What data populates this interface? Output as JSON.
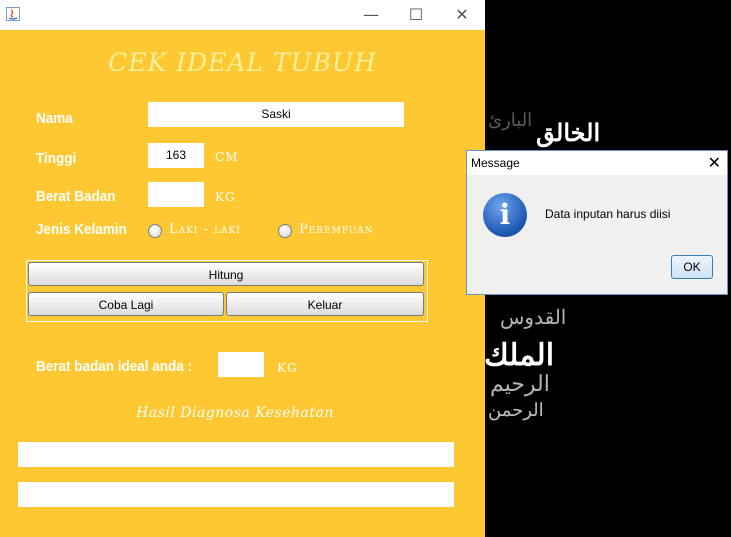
{
  "window": {
    "minimize_glyph": "—",
    "maximize_glyph": "☐",
    "close_glyph": "✕"
  },
  "form": {
    "title": "CEK IDEAL TUBUH",
    "nama_label": "Nama",
    "nama_value": "Saski",
    "tinggi_label": "Tinggi",
    "tinggi_value": "163",
    "tinggi_unit": "CM",
    "berat_label": "Berat Badan",
    "berat_value": "",
    "berat_unit": "KG",
    "gender_label": "Jenis Kelamin",
    "gender_options": [
      "Laki - laki",
      "Perempuan"
    ],
    "hitung_button": "Hitung",
    "coba_lagi_button": "Coba Lagi",
    "keluar_button": "Keluar",
    "ideal_label": "Berat badan ideal anda :",
    "ideal_value": "",
    "ideal_unit": "KG",
    "diagnosa_heading": "Hasil Diagnosa Kesehatan",
    "diagnosa_1": "",
    "diagnosa_2": ""
  },
  "dialog": {
    "title": "Message",
    "message": "Data inputan harus diisi",
    "ok_button": "OK",
    "close_glyph": "✕",
    "icon": "info-icon"
  },
  "background": {
    "calligraphy": [
      "الخالق",
      "البارئ",
      "القدوس",
      "الملك",
      "الرحيم",
      "الرحمن"
    ]
  },
  "colors": {
    "window_bg": "#FEC832",
    "heading": "#F7F29A",
    "desktop": "#000000"
  }
}
